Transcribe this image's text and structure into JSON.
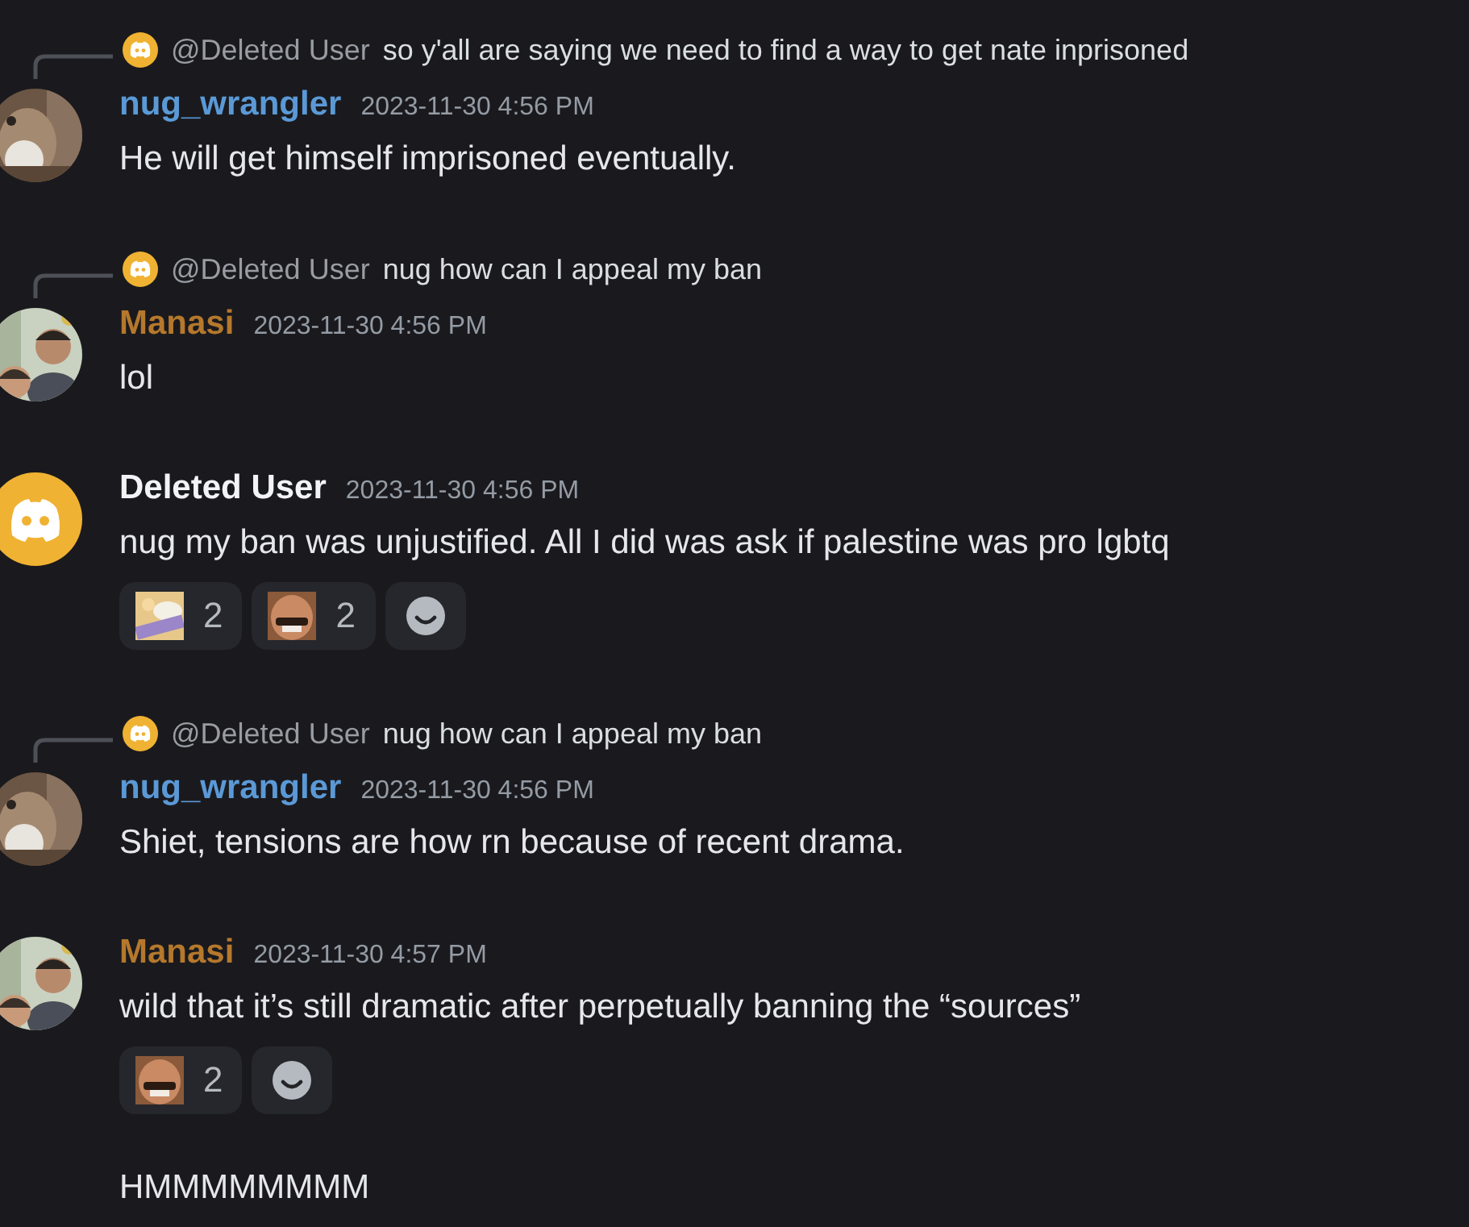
{
  "messages": [
    {
      "reply": {
        "author": "@Deleted User",
        "text": "so y'all are saying we need to find a way to get nate inprisoned"
      },
      "avatar": {
        "kind": "picture"
      },
      "author": "nug_wrangler",
      "color": "#5b99d6",
      "time": "2023-11-30 4:56 PM",
      "lines": [
        "He will get himself imprisoned eventually."
      ]
    },
    {
      "reply": {
        "author": "@Deleted User",
        "text": "nug how can I appeal my ban"
      },
      "avatar": {
        "kind": "picture"
      },
      "author": "Manasi",
      "color": "#b5782c",
      "time": "2023-11-30 4:56 PM",
      "lines": [
        "lol"
      ]
    },
    {
      "avatar": {
        "kind": "default"
      },
      "author": "Deleted User",
      "color": "#f2f3f5",
      "time": "2023-11-30 4:56 PM",
      "lines": [
        "nug my ban was unjustified. All I did was ask if palestine was pro lgbtq"
      ],
      "reactions": [
        {
          "kind": "emoji",
          "count": "2"
        },
        {
          "kind": "emoji",
          "count": "2"
        },
        {
          "kind": "add"
        }
      ]
    },
    {
      "reply": {
        "author": "@Deleted User",
        "text": "nug how can I appeal my ban"
      },
      "avatar": {
        "kind": "picture"
      },
      "author": "nug_wrangler",
      "color": "#5b99d6",
      "time": "2023-11-30 4:56 PM",
      "lines": [
        "Shiet, tensions are how rn because of recent drama."
      ]
    },
    {
      "avatar": {
        "kind": "picture"
      },
      "author": "Manasi",
      "color": "#b5782c",
      "time": "2023-11-30 4:57 PM",
      "lines": [
        "wild that it’s still dramatic after perpetually banning the “sources”"
      ],
      "reactions": [
        {
          "kind": "emoji",
          "count": "2"
        },
        {
          "kind": "add"
        }
      ],
      "followups": [
        "HMMMMMMMM"
      ]
    }
  ]
}
